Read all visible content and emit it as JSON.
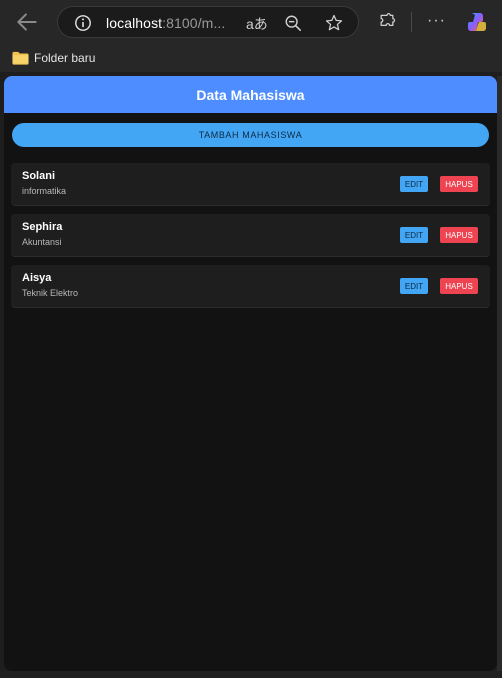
{
  "browser": {
    "url_host": "localhost",
    "url_path": ":8100/m...",
    "read_aloud_glyph": "aあ",
    "more_glyph": "···"
  },
  "bookmarks": {
    "folder_label": "Folder baru"
  },
  "app": {
    "title": "Data Mahasiswa",
    "add_button_label": "TAMBAH MAHASISWA",
    "edit_label": "EDIT",
    "delete_label": "HAPUS",
    "accent_color": "#4d8dff",
    "button_color": "#42a6f5",
    "danger_color": "#ee4452"
  },
  "students": [
    {
      "name": "Solani",
      "major": "informatika"
    },
    {
      "name": "Sephira",
      "major": "Akuntansi"
    },
    {
      "name": "Aisya",
      "major": "Teknik Elektro"
    }
  ]
}
